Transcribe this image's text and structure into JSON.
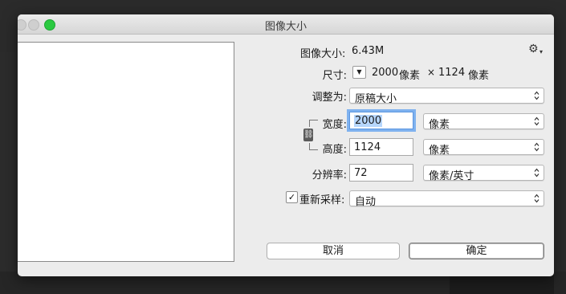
{
  "window": {
    "title": "图像大小"
  },
  "image_size": {
    "label": "图像大小:",
    "value": "6.43M"
  },
  "dimensions": {
    "label": "尺寸:",
    "width": "2000",
    "width_unit": "像素",
    "separator": "×",
    "height": "1124",
    "height_unit": "像素"
  },
  "fit_to": {
    "label": "调整为:",
    "value": "原稿大小"
  },
  "width": {
    "label": "宽度:",
    "value": "2000",
    "unit": "像素"
  },
  "height": {
    "label": "高度:",
    "value": "1124",
    "unit": "像素"
  },
  "resolution": {
    "label": "分辨率:",
    "value": "72",
    "unit": "像素/英寸"
  },
  "resample": {
    "label": "重新采样:",
    "checked": true,
    "value": "自动"
  },
  "buttons": {
    "cancel": "取消",
    "ok": "确定"
  },
  "icons": {
    "settings": "gear-icon",
    "constrain": "link-icon"
  }
}
